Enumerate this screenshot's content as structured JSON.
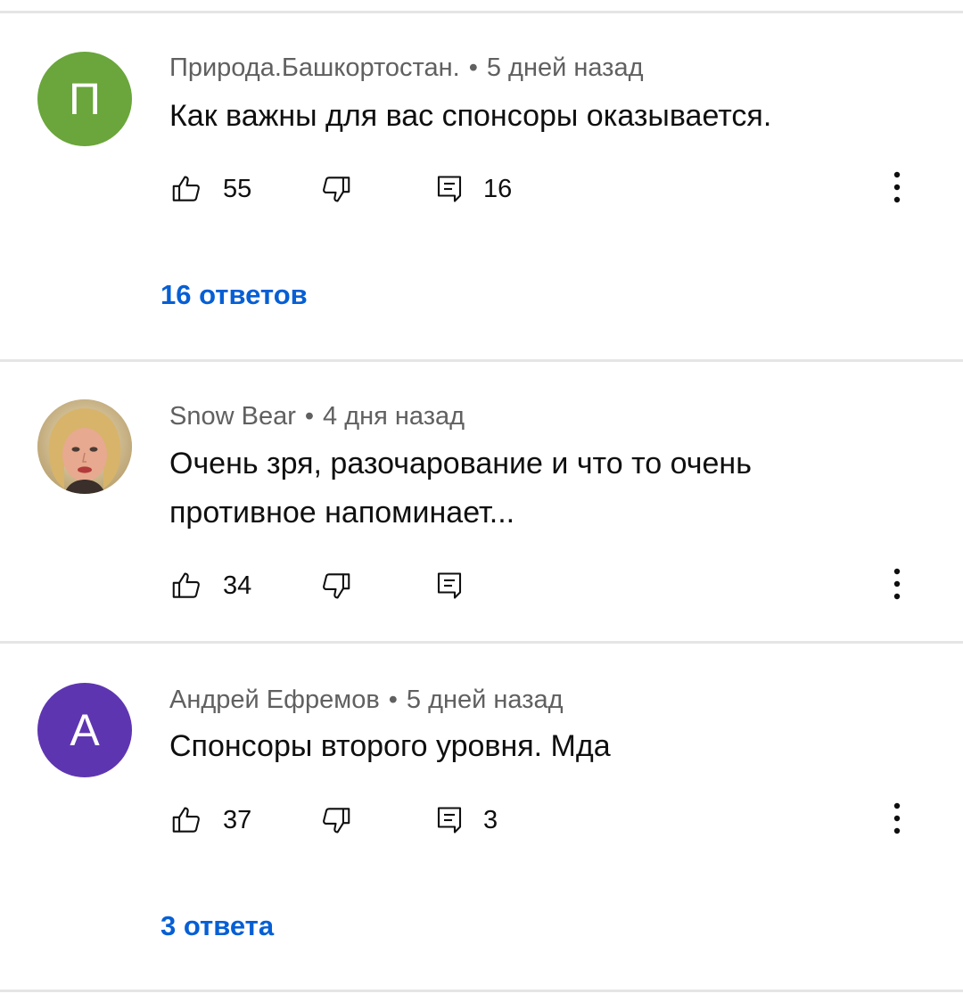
{
  "comments": [
    {
      "author": "Природа.Башкортостан.",
      "separator": "•",
      "time": "5 дней назад",
      "text": "Как важны для вас спонсоры оказывается.",
      "avatar_letter": "П",
      "avatar_color": "#6aa63b",
      "likes": "55",
      "reply_count": "16",
      "replies_link": "16 ответов"
    },
    {
      "author": "Snow Bear",
      "separator": "•",
      "time": "4 дня назад",
      "text": "Очень зря, разочарование и что то  очень противное напоминает...",
      "avatar_type": "photo",
      "likes": "34"
    },
    {
      "author": "Андрей Ефремов",
      "separator": "•",
      "time": "5 дней назад",
      "text": "Спонсоры второго уровня. Мда",
      "avatar_letter": "А",
      "avatar_color": "#5e35b1",
      "likes": "37",
      "reply_count": "3",
      "replies_link": "3 ответа"
    }
  ],
  "colors": {
    "link": "#065fd4",
    "meta": "#606060",
    "divider": "#e5e5e5"
  },
  "icons": {
    "like": "thumb-up-icon",
    "dislike": "thumb-down-icon",
    "reply": "reply-icon",
    "menu": "more-vert-icon"
  }
}
